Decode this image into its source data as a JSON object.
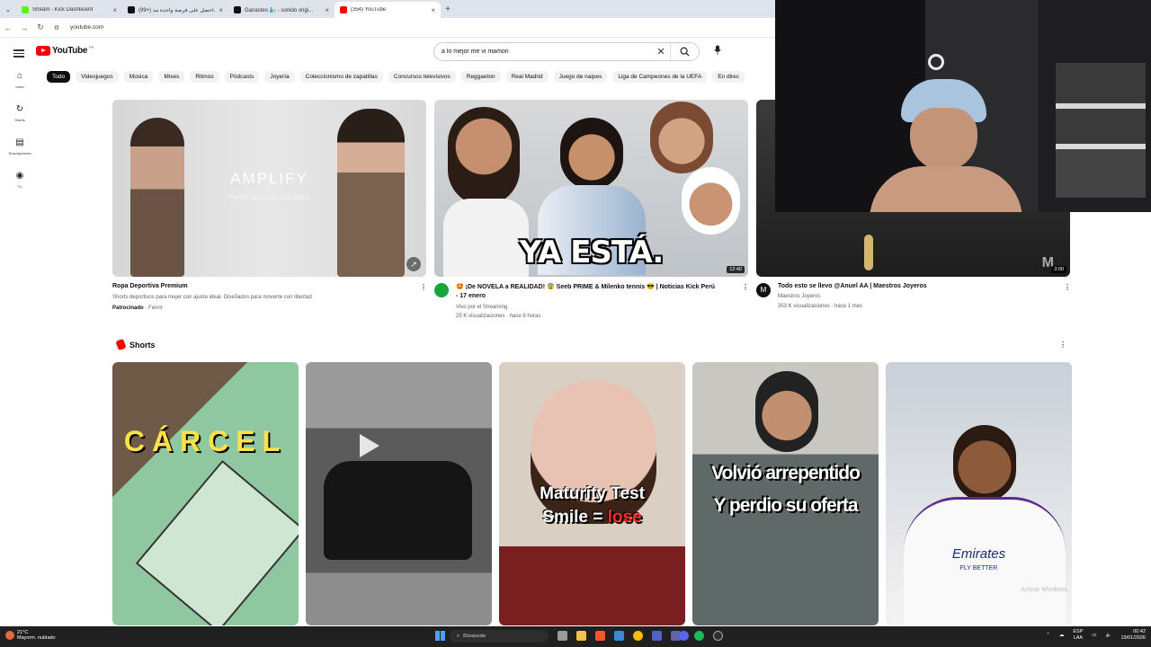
{
  "browser": {
    "tabs": [
      {
        "title": "Stream - Kick Dashboard",
        "color": "#53fc18",
        "active": false
      },
      {
        "title": "(99+) احصل على فرصة واحدة مد...",
        "color": "#111111",
        "active": false
      },
      {
        "title": "Ganasteo 🧞‍♂️ - sonido origi...",
        "color": "#111111",
        "active": false
      },
      {
        "title": "(354) YouTube",
        "color": "#ff0000",
        "active": true
      }
    ],
    "url": "youtube.com"
  },
  "youtube": {
    "logo_text": "YouTube",
    "country_code": "PE",
    "search_value": "a lo mejor me vi mamon",
    "sidebar": [
      {
        "icon": "home-icon",
        "glyph": "⌂",
        "label": "Inicio"
      },
      {
        "icon": "shorts-icon",
        "glyph": "↻",
        "label": "Shorts"
      },
      {
        "icon": "subscriptions-icon",
        "glyph": "▤",
        "label": "Suscripciones"
      },
      {
        "icon": "you-icon",
        "glyph": "◉",
        "label": "Tú"
      }
    ],
    "chips": [
      "Todo",
      "Videojuegos",
      "Música",
      "Mixes",
      "Ritmos",
      "Pódcasts",
      "Joyería",
      "Coleccionismo de zapatillas",
      "Concursos televisivos",
      "Reggaeton",
      "Real Madrid",
      "Juego de naipes",
      "Liga de Campeones de la UEFA",
      "En direc"
    ],
    "videos": [
      {
        "title": "Ropa Deportiva Premium",
        "line2": "Shorts deportivos para mujer con ajuste ideal. Diseñados para moverte con libertad",
        "sponsored": "Patrocinado",
        "advertiser": "Fenrir",
        "thumb_text": "AMPLIFY",
        "thumb_sub": "Hecho para hacerte brillar"
      },
      {
        "title": "🤩 ¡De NOVELA a REALIDAD! 😨 Seeb PRIME & Milenko tennis 😎 | Noticias Kick Perú",
        "title2": "- 17 enero",
        "channel": "Vivo por el Streaming",
        "stats": "25 K visualizaciones · hace 8 horas",
        "duration": "12:40",
        "thumb_text": "YA ESTÁ."
      },
      {
        "title": "Todo esto se llevo @Anuel AA | Maestros Joyeros",
        "channel": "Maestros Joyeros",
        "stats": "353 K visualizaciones · hace 1 mes",
        "duration": "3:00",
        "avatar_letter": "M"
      }
    ],
    "shorts_label": "Shorts",
    "shorts": [
      {
        "text": "CÁRCEL",
        "bg": "#6a9a7a"
      },
      {
        "text": "",
        "bg": "#6b6b6b"
      },
      {
        "text": "Maturity Test",
        "text2": "Smile = ",
        "text3": "lose",
        "bg": "#c9b8a8"
      },
      {
        "text": "Volvió arrepentido",
        "text2": "Y perdio su oferta",
        "bg": "#8a8c86"
      },
      {
        "text": "Emirates",
        "text2": "FLY BETTER",
        "bg": "#e8ecf2"
      }
    ]
  },
  "watermark": "Activar Windows",
  "taskbar": {
    "temp": "21°C",
    "weather": "Mayorm. nublado",
    "search": "Búsqueda",
    "lang": "ESP",
    "lang2": "LAA",
    "time": "00:42",
    "date": "19/01/2026"
  }
}
